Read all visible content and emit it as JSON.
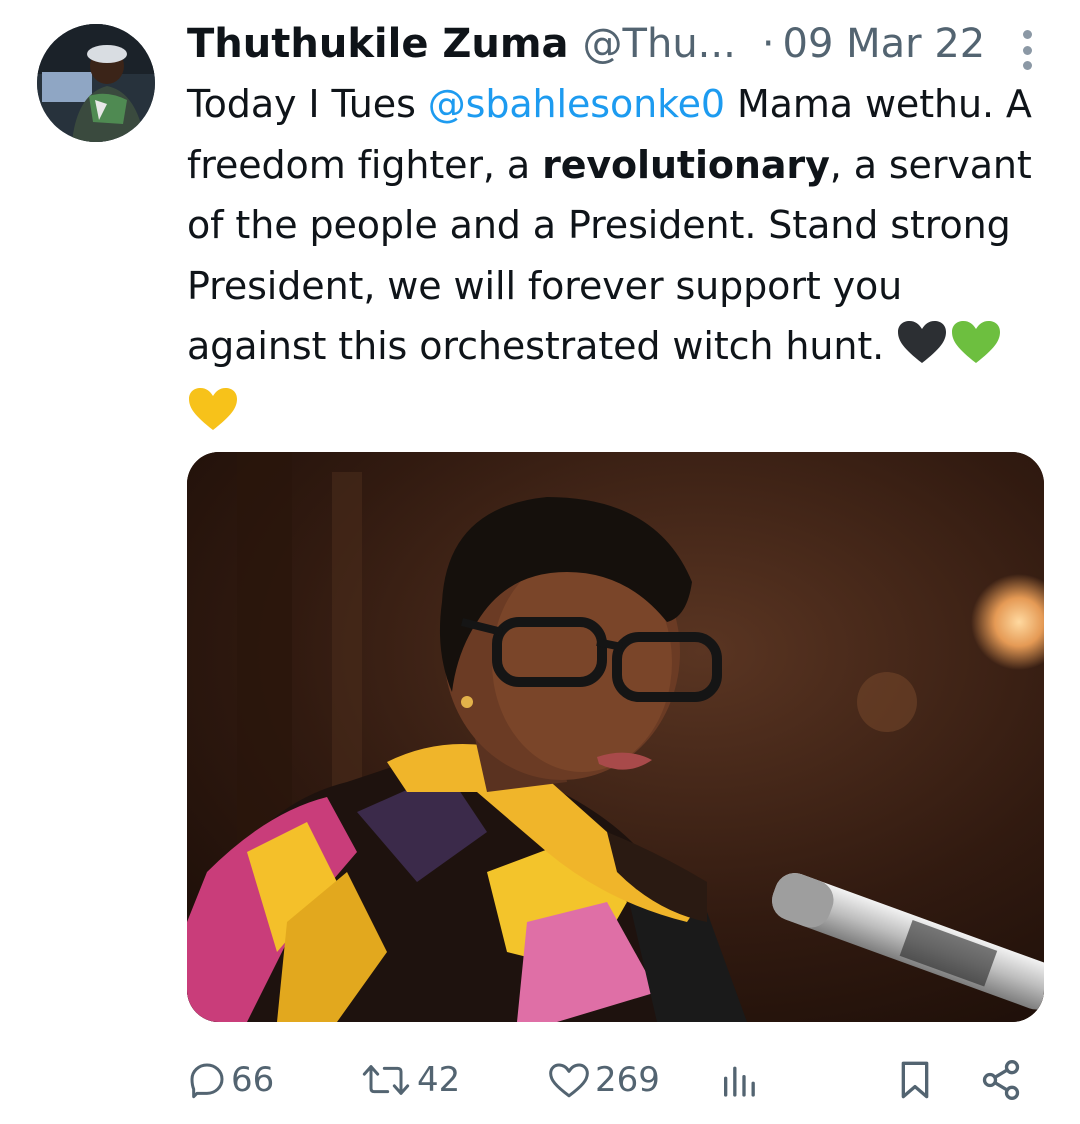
{
  "author": {
    "display_name": "Thuthukile Zuma",
    "handle": "@Thu...",
    "separator": "·",
    "date": "09 Mar 22"
  },
  "tweet": {
    "line1_prefix": "Today I Tues ",
    "mention": "@sbahlesonke0",
    "line1_suffix": " Mama wethu. A freedom fighter, a ",
    "bold_word": "revolutionary",
    "rest": ", a servant of the people and a President. Stand strong President, we will forever support you against this orchestrated witch hunt. ",
    "emojis": [
      "black-heart-icon",
      "green-heart-icon",
      "yellow-heart-icon"
    ]
  },
  "actions": {
    "replies": "66",
    "retweets": "42",
    "likes": "269"
  },
  "colors": {
    "accent": "#1d9bf0",
    "muted": "#536471",
    "text": "#0f1419"
  }
}
